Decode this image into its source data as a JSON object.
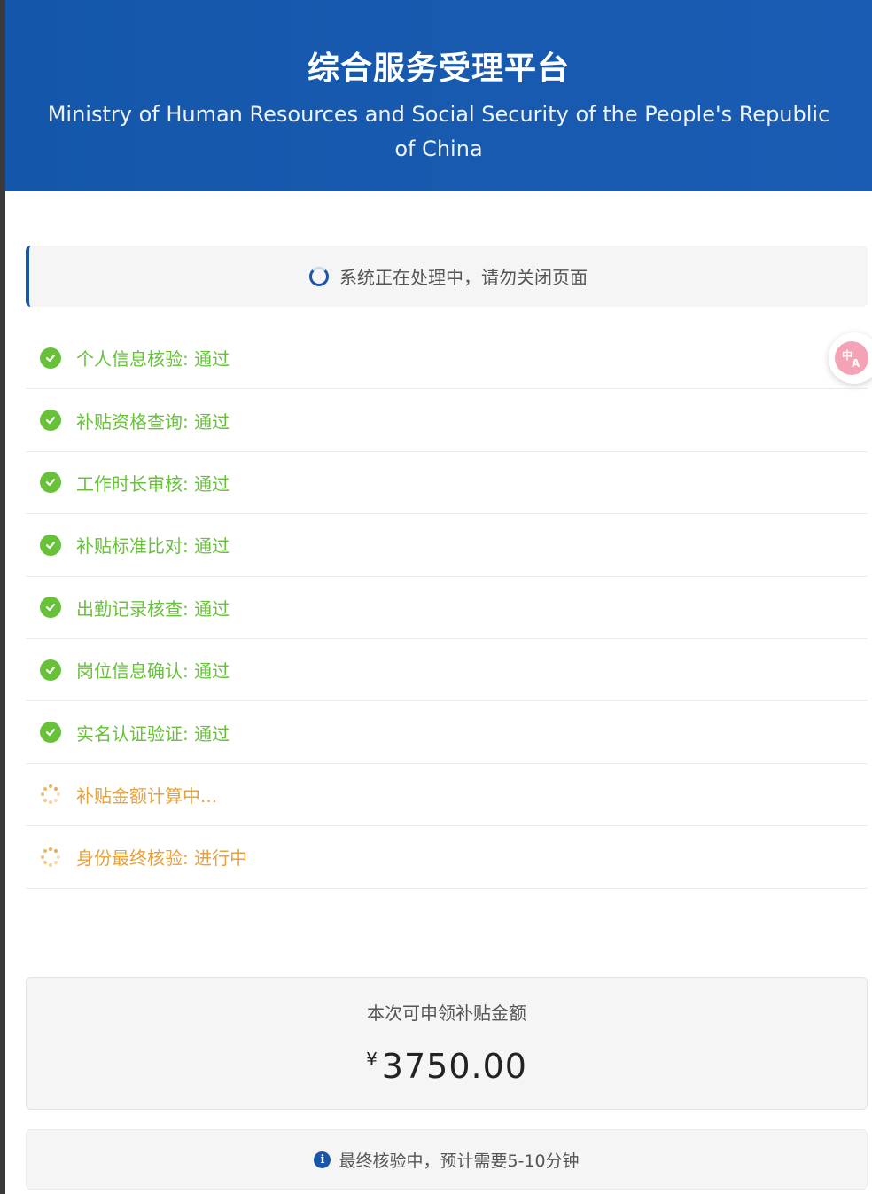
{
  "header": {
    "title": "综合服务受理平台",
    "subtitle": "Ministry of Human Resources and Social Security of the People's Republic of China"
  },
  "status_banner": {
    "text": "系统正在处理中，请勿关闭页面",
    "icon": "loading-spinner-icon"
  },
  "steps": [
    {
      "label": "个人信息核验: 通过",
      "state": "done",
      "icon": "check-circle-icon"
    },
    {
      "label": "补贴资格查询: 通过",
      "state": "done",
      "icon": "check-circle-icon"
    },
    {
      "label": "工作时长审核: 通过",
      "state": "done",
      "icon": "check-circle-icon"
    },
    {
      "label": "补贴标准比对: 通过",
      "state": "done",
      "icon": "check-circle-icon"
    },
    {
      "label": "出勤记录核查: 通过",
      "state": "done",
      "icon": "check-circle-icon"
    },
    {
      "label": "岗位信息确认: 通过",
      "state": "done",
      "icon": "check-circle-icon"
    },
    {
      "label": "实名认证验证: 通过",
      "state": "done",
      "icon": "check-circle-icon"
    },
    {
      "label": "补贴金额计算中...",
      "state": "pending",
      "icon": "loading-dots-icon"
    },
    {
      "label": "身份最终核验: 进行中",
      "state": "pending",
      "icon": "loading-dots-icon"
    }
  ],
  "amount_card": {
    "label": "本次可申领补贴金额",
    "currency": "¥",
    "amount": "3750.00"
  },
  "info_card": {
    "text": "最终核验中，预计需要5-10分钟",
    "icon": "info-icon"
  },
  "translate_button": {
    "icon": "translate-icon"
  },
  "colors": {
    "header_bg": "#1557a9",
    "success": "#67c23a",
    "pending": "#e6a23c",
    "accent": "#1a56a8"
  }
}
